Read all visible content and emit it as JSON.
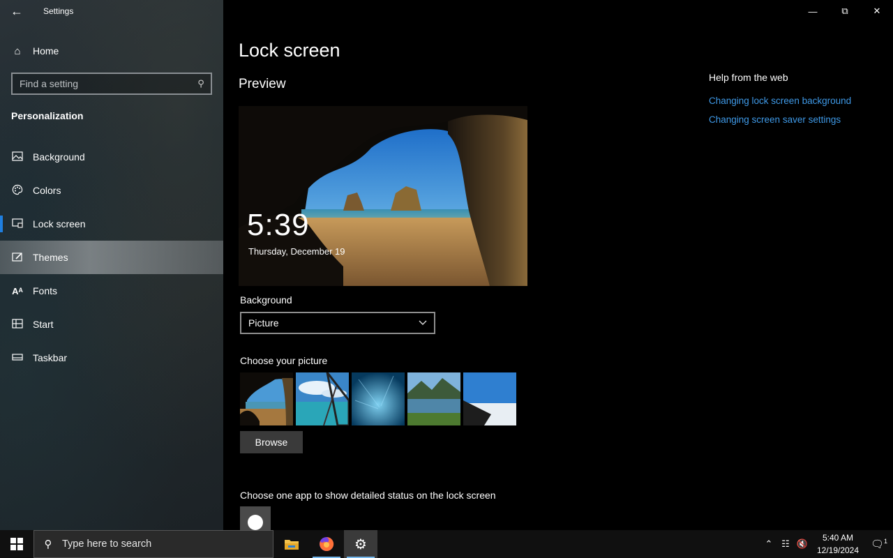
{
  "window": {
    "title": "Settings",
    "back_icon": "back-arrow-icon"
  },
  "sidebar": {
    "home_label": "Home",
    "search_placeholder": "Find a setting",
    "section_title": "Personalization",
    "items": [
      {
        "label": "Background",
        "icon": "picture-icon"
      },
      {
        "label": "Colors",
        "icon": "palette-icon"
      },
      {
        "label": "Lock screen",
        "icon": "lock-screen-icon",
        "active": true
      },
      {
        "label": "Themes",
        "icon": "brush-icon",
        "hover": true
      },
      {
        "label": "Fonts",
        "icon": "fonts-icon"
      },
      {
        "label": "Start",
        "icon": "start-icon"
      },
      {
        "label": "Taskbar",
        "icon": "taskbar-icon"
      }
    ]
  },
  "main": {
    "page_title": "Lock screen",
    "preview_title": "Preview",
    "preview_time": "5:39",
    "preview_date": "Thursday, December 19",
    "background_label": "Background",
    "background_value": "Picture",
    "choose_picture_label": "Choose your picture",
    "browse_label": "Browse",
    "status_label": "Choose one app to show detailed status on the lock screen"
  },
  "help": {
    "title": "Help from the web",
    "links": [
      "Changing lock screen background",
      "Changing screen saver settings"
    ]
  },
  "taskbar": {
    "search_placeholder": "Type here to search",
    "time": "5:40 AM",
    "date": "12/19/2024",
    "notification_count": "1"
  },
  "colors": {
    "accent": "#1f7fe0",
    "link": "#3f9ae8",
    "taskbar": "#101010"
  }
}
